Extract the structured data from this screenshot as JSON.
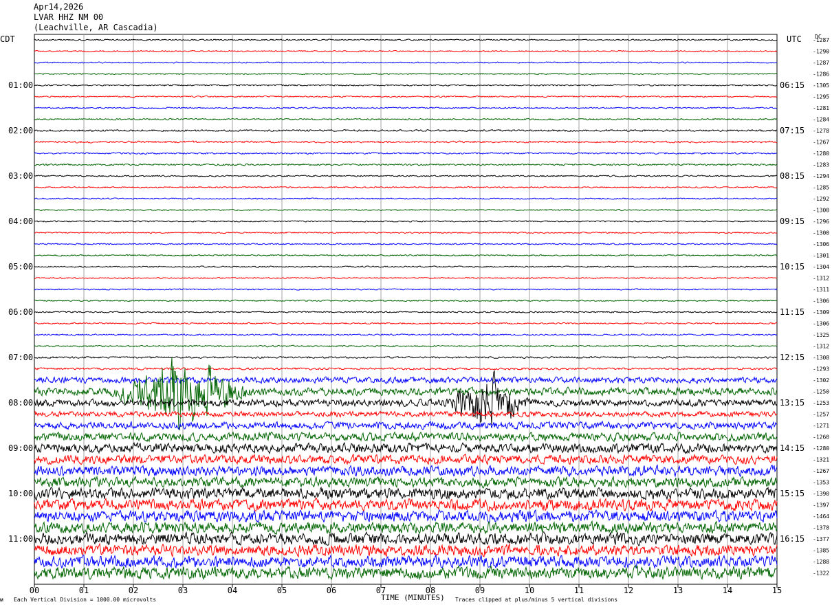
{
  "header": {
    "date": "Apr14,2026",
    "station": "LVAR HHZ NM 00",
    "location": "(Leachville, AR Cascadia)"
  },
  "left_axis_label": "CDT",
  "right_axis_label": "UTC",
  "dc_label": "DC",
  "footer": {
    "left": "Each Vertical Division = 1000.00 microvolts",
    "center": "TIME (MINUTES)",
    "right": "Traces clipped at plus/minus 5 vertical divisions",
    "corner_mark": "ᴍ"
  },
  "colors": {
    "trace_cycle": [
      "#000000",
      "#ff0000",
      "#0000ff",
      "#006400"
    ],
    "grid": "#a0a0a0",
    "frame": "#000000"
  },
  "chart_data": {
    "type": "line",
    "title": "LVAR HHZ NM 00",
    "xlabel": "TIME (MINUTES)",
    "xlim": [
      0,
      15
    ],
    "x_ticks": [
      "00",
      "01",
      "02",
      "03",
      "04",
      "05",
      "06",
      "07",
      "08",
      "09",
      "10",
      "11",
      "12",
      "13",
      "14",
      "15"
    ],
    "left_hour_labels": [
      "01:00",
      "02:00",
      "03:00",
      "04:00",
      "05:00",
      "06:00",
      "07:00",
      "08:00",
      "09:00",
      "10:00",
      "11:00"
    ],
    "right_hour_labels": [
      "06:15",
      "07:15",
      "08:15",
      "09:15",
      "10:15",
      "11:15",
      "12:15",
      "13:15",
      "14:15",
      "15:15",
      "16:15"
    ],
    "traces_per_hour": 4,
    "trace_count": 48,
    "dc_offsets": [
      -1287,
      -1290,
      -1287,
      -1286,
      -1305,
      -1295,
      -1281,
      -1284,
      -1278,
      -1267,
      -1280,
      -1283,
      -1294,
      -1285,
      -1292,
      -1300,
      -1296,
      -1300,
      -1306,
      -1301,
      -1304,
      -1312,
      -1311,
      -1306,
      -1309,
      -1306,
      -1325,
      -1312,
      -1308,
      -1293,
      -1302,
      -1250,
      -1253,
      -1257,
      -1271,
      -1260,
      -1280,
      -1321,
      -1267,
      -1353,
      -1390,
      -1397,
      -1464,
      -1378,
      -1377,
      -1385,
      -1288,
      -1322
    ],
    "noise_level": [
      0.22,
      0.22,
      0.22,
      0.22,
      0.24,
      0.22,
      0.22,
      0.24,
      0.3,
      0.32,
      0.28,
      0.28,
      0.24,
      0.22,
      0.22,
      0.22,
      0.22,
      0.22,
      0.22,
      0.22,
      0.22,
      0.22,
      0.22,
      0.22,
      0.24,
      0.24,
      0.26,
      0.26,
      0.3,
      0.34,
      1.0,
      1.3,
      1.2,
      0.9,
      1.2,
      1.4,
      1.6,
      1.5,
      1.7,
      1.7,
      1.9,
      1.9,
      1.9,
      1.9,
      2.0,
      1.9,
      2.0,
      2.1
    ],
    "events": [
      {
        "trace": 31,
        "start_min": 1.5,
        "end_min": 4.4,
        "peak": 3.0
      },
      {
        "trace": 32,
        "start_min": 8.3,
        "end_min": 10.0,
        "peak": 2.6
      }
    ]
  }
}
